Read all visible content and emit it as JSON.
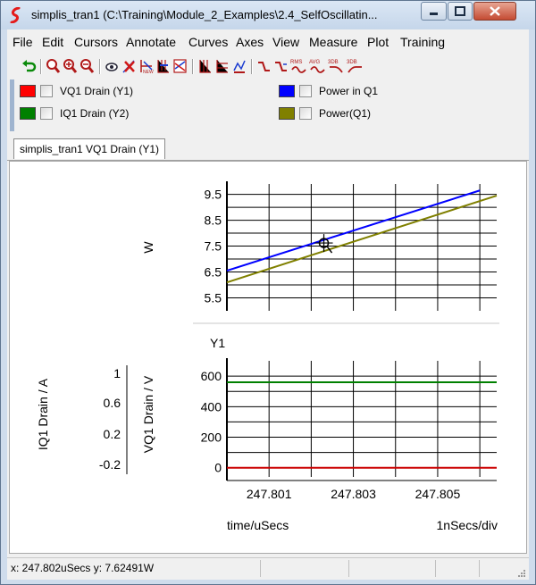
{
  "window": {
    "title": "simplis_tran1 (C:\\Training\\Module_2_Examples\\2.4_SelfOscillatin..."
  },
  "menu": {
    "file": "File",
    "edit": "Edit",
    "cursors": "Cursors",
    "annotate": "Annotate",
    "curves": "Curves",
    "axes": "Axes",
    "view": "View",
    "measure": "Measure",
    "plot": "Plot",
    "training": "Training"
  },
  "toolbar": {
    "icons": [
      "undo-icon",
      "zoom-box-icon",
      "zoom-in-icon",
      "zoom-out-icon",
      "eye-icon",
      "delete-curve-icon",
      "new-grid-icon",
      "new-axis-icon",
      "stack-icon",
      "cursor-vertical-icon",
      "cursor-horizontal-icon",
      "measure-icon",
      "rise-icon",
      "fall-icon",
      "rms-icon",
      "avg-icon",
      "3db-icon",
      "3db-high-icon"
    ],
    "mini_labels": {
      "rms": "RMS",
      "avg": "AVG",
      "db1": "3DB",
      "db2": "3DB"
    }
  },
  "legend": [
    {
      "label": "VQ1 Drain (Y1)",
      "color": "#ff0000"
    },
    {
      "label": "IQ1 Drain (Y2)",
      "color": "#008000"
    },
    {
      "label": "Power in Q1",
      "color": "#0000ff"
    },
    {
      "label": "Power(Q1)",
      "color": "#808000"
    }
  ],
  "tab": {
    "label": "simplis_tran1 VQ1 Drain (Y1)"
  },
  "chart_data": [
    {
      "type": "line",
      "ylabel": "W",
      "yticks": [
        "9.5",
        "8.5",
        "7.5",
        "6.5",
        "5.5"
      ],
      "ylim": [
        5.0,
        9.9
      ],
      "xlim": [
        247.8,
        247.8064
      ],
      "series": [
        {
          "name": "Power in Q1",
          "color": "#0000ff",
          "x": [
            247.8,
            247.806
          ],
          "y": [
            6.55,
            9.65
          ]
        },
        {
          "name": "Power(Q1)",
          "color": "#808000",
          "x": [
            247.8,
            247.8064
          ],
          "y": [
            6.1,
            9.45
          ]
        }
      ],
      "cursor": {
        "x": 247.8023,
        "y": 7.62
      },
      "grid": true
    },
    {
      "type": "line",
      "axis_group_label": "Y1",
      "ylabel": "VQ1 Drain / V",
      "yticks": [
        "600",
        "400",
        "200",
        "0"
      ],
      "ylim": [
        -60,
        700
      ],
      "y2label": "IQ1 Drain / A",
      "y2ticks": [
        "1",
        "0.6",
        "0.2",
        "-0.2"
      ],
      "xlabel": "time/uSecs",
      "xticks": [
        "247.801",
        "247.803",
        "247.805"
      ],
      "xlim": [
        247.8,
        247.8064
      ],
      "xdiv_label": "1nSecs/div",
      "series": [
        {
          "name": "VQ1 Drain (Y1)",
          "color": "#cc0000",
          "x": [
            247.8,
            247.8064
          ],
          "y": [
            0,
            0
          ]
        },
        {
          "name": "IQ1 Drain (Y2)",
          "color": "#008000",
          "x": [
            247.8,
            247.8064
          ],
          "y": [
            560,
            560
          ]
        }
      ],
      "grid": true
    }
  ],
  "status": {
    "x_readout": "x: 247.802uSecs",
    "y_readout": "y: 7.62491W"
  }
}
